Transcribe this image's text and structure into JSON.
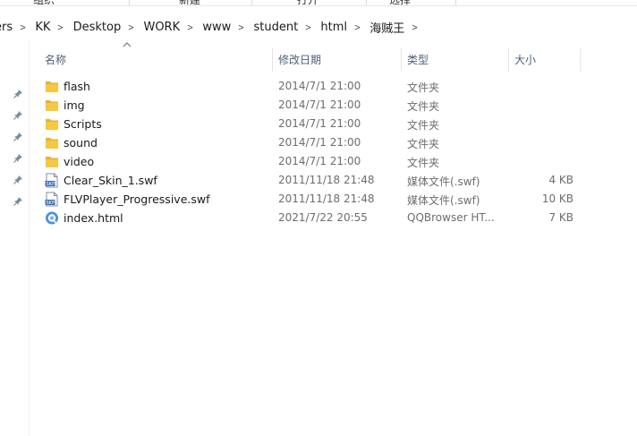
{
  "ribbon": {
    "groups": [
      "组织",
      "新建",
      "打开",
      "选择"
    ]
  },
  "breadcrumb": {
    "items": [
      "ers",
      "KK",
      "Desktop",
      "WORK",
      "www",
      "student",
      "html",
      "海贼王"
    ]
  },
  "columns": {
    "name": "名称",
    "modified": "修改日期",
    "type": "类型",
    "size": "大小"
  },
  "files": [
    {
      "name": "flash",
      "modified": "2014/7/1 21:00",
      "type": "文件夹",
      "size": "",
      "icon": "folder-icon"
    },
    {
      "name": "img",
      "modified": "2014/7/1 21:00",
      "type": "文件夹",
      "size": "",
      "icon": "folder-icon"
    },
    {
      "name": "Scripts",
      "modified": "2014/7/1 21:00",
      "type": "文件夹",
      "size": "",
      "icon": "folder-icon"
    },
    {
      "name": "sound",
      "modified": "2014/7/1 21:00",
      "type": "文件夹",
      "size": "",
      "icon": "folder-icon"
    },
    {
      "name": "video",
      "modified": "2014/7/1 21:00",
      "type": "文件夹",
      "size": "",
      "icon": "folder-icon"
    },
    {
      "name": "Clear_Skin_1.swf",
      "modified": "2011/11/18 21:48",
      "type": "媒体文件(.swf)",
      "size": "4 KB",
      "icon": "swf-file-icon"
    },
    {
      "name": "FLVPlayer_Progressive.swf",
      "modified": "2011/11/18 21:48",
      "type": "媒体文件(.swf)",
      "size": "10 KB",
      "icon": "swf-file-icon"
    },
    {
      "name": "index.html",
      "modified": "2021/7/22 20:55",
      "type": "QQBrowser HT...",
      "size": "7 KB",
      "icon": "html-file-icon"
    }
  ],
  "colors": {
    "header_text": "#4c607a",
    "folder_yellow": "#f5c743",
    "detail_text": "#6d6d6d"
  }
}
